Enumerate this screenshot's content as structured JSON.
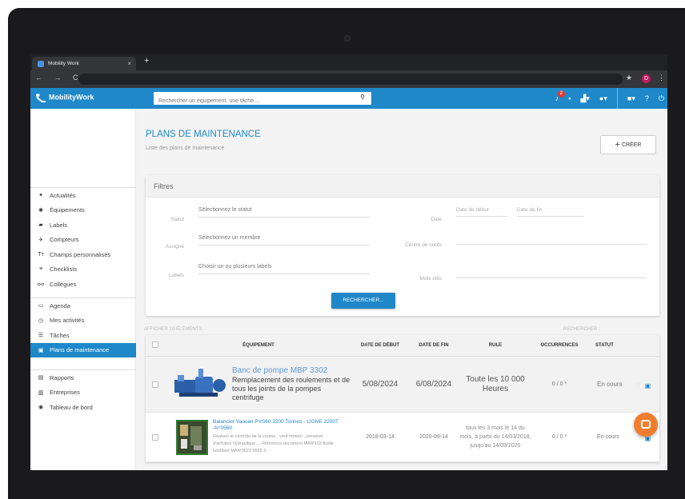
{
  "browser": {
    "tab_title": "Mobility Work",
    "tab_close": "×",
    "new_tab": "+",
    "nav": "← → C",
    "star": "★",
    "profile": "D",
    "menu": "⋮"
  },
  "app": {
    "logo": "MobilityWork",
    "search_placeholder": "Rechercher un équipement, une tâche ...",
    "notif_count": "2"
  },
  "sidebar": {
    "group1": [
      {
        "icon": "feed-icon",
        "glyph": "✦",
        "label": "Actualités"
      },
      {
        "icon": "gear-icon",
        "glyph": "✱",
        "label": "Équipements"
      },
      {
        "icon": "tag-icon",
        "glyph": "▰",
        "label": "Labels"
      },
      {
        "icon": "meter-icon",
        "glyph": "✈",
        "label": "Compteurs"
      },
      {
        "icon": "text-icon",
        "glyph": "Tт",
        "label": "Champs personnalisés"
      },
      {
        "icon": "checklist-icon",
        "glyph": "≡",
        "label": "Checklists"
      },
      {
        "icon": "people-icon",
        "glyph": "ⴰⴰ",
        "label": "Collègues"
      }
    ],
    "group2": [
      {
        "icon": "calendar-icon",
        "glyph": "▭",
        "label": "Agenda"
      },
      {
        "icon": "clock-icon",
        "glyph": "◷",
        "label": "Mes activités"
      },
      {
        "icon": "list-icon",
        "glyph": "☰",
        "label": "Tâches"
      },
      {
        "icon": "plan-icon",
        "glyph": "▣",
        "label": "Plans de maintenance",
        "active": true
      }
    ],
    "group3": [
      {
        "icon": "report-icon",
        "glyph": "▤",
        "label": "Rapports"
      },
      {
        "icon": "building-icon",
        "glyph": "▥",
        "label": "Entreprises"
      },
      {
        "icon": "dashboard-icon",
        "glyph": "◉",
        "label": "Tableau de bord"
      }
    ]
  },
  "page": {
    "title": "PLANS DE MAINTENANCE",
    "subtitle": "Liste des plans de maintenance",
    "create_label": "CRÉER"
  },
  "filters": {
    "heading": "Filtres",
    "statut_label": "Statut",
    "statut_value": "Sélectionnez le statut",
    "assigne_label": "Assigné",
    "assigne_value": "Sélectionnez un membre",
    "labels_label": "Labels",
    "labels_value": "Choisir un ou plusieurs labels",
    "date_label": "Date",
    "date_start": "Date de début",
    "date_end": "Date de fin",
    "centre_label": "Centre de coûts",
    "mots_label": "Mots clés",
    "search_button": "RECHERCHER..."
  },
  "list": {
    "meta": "AFFICHER 10 ÉLÉMENTS",
    "search": "RECHERCHER :",
    "headers": {
      "equipment": "ÉQUIPEMENT",
      "start": "DATE DE DÉBUT",
      "end": "DATE DE FIN",
      "rule": "RULE",
      "occurrences": "OCCURRENCES",
      "status": "STATUT"
    },
    "rows": [
      {
        "title": "Banc de pompe MBP 3302",
        "desc": "Remplacement des roulements et de tous les joints de la pompes centrifuge",
        "start": "5/08/2024",
        "end": "6/08/2024",
        "rule": "Toute les 10 000 Heures",
        "occ": "0 / 0 *",
        "status": "En cours"
      },
      {
        "title": "Balancier Vaocari PVS60 3200 Tonnes - LIGNE 3200T -N°0560",
        "desc": "Réaliser le contrôle de la course , vérif moteur , pression d'airfuites hydraulique ... Référence document MAIP102 fluide lubrifiant MAIP3023 5565 3",
        "start": "2018-03-14",
        "end": "2020-09-14",
        "rule": "tous les 3 mois le 14 du mois, à partir du 14/03/2018, jusqu'au 14/09/2020",
        "occ": "0 / 0 *",
        "status": "En cours"
      }
    ]
  }
}
